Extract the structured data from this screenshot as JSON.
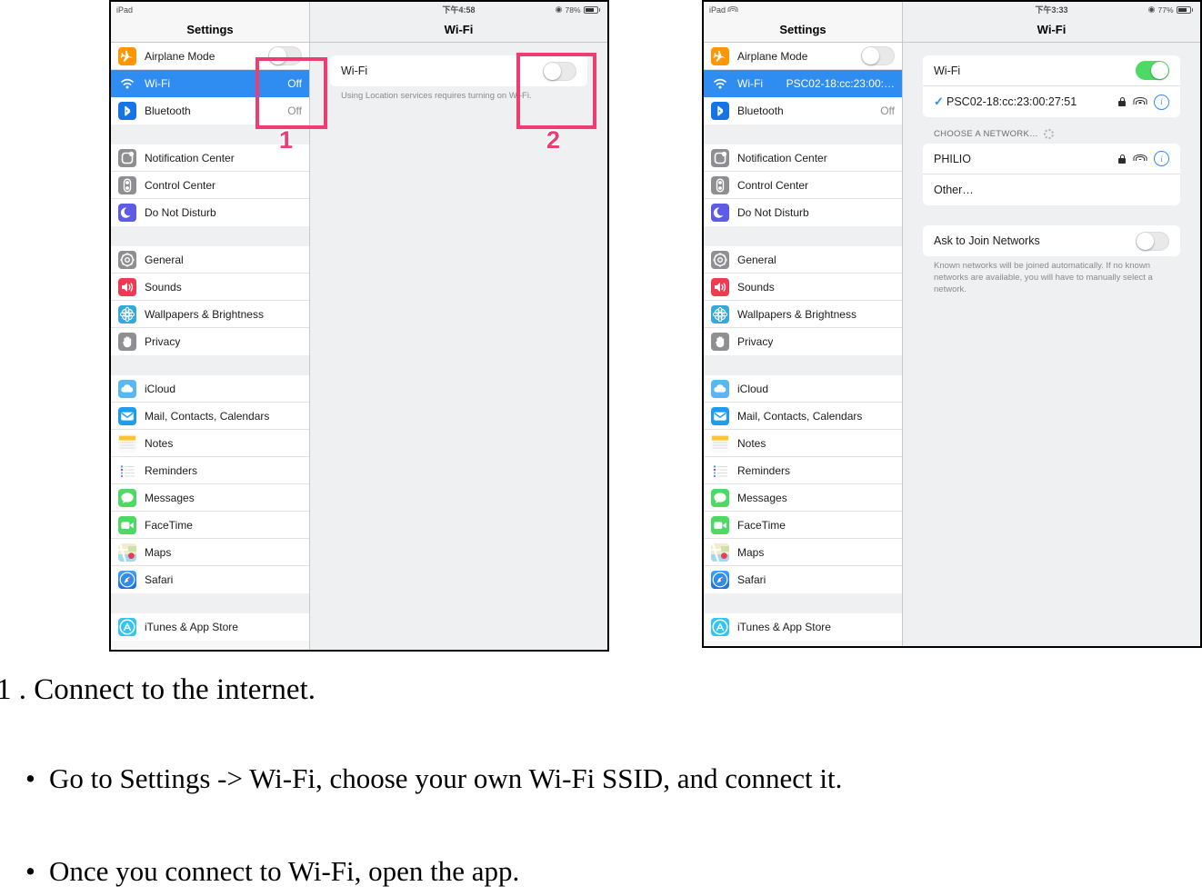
{
  "left_device": {
    "status": {
      "device": "iPad",
      "time": "下午4:58",
      "battery_pct": "78%",
      "battery_level": 78
    },
    "sidebar_title": "Settings",
    "detail_title": "Wi-Fi",
    "groups": [
      {
        "items": [
          {
            "label": "Airplane Mode",
            "icon": "airplane-icon",
            "control": "toggle",
            "toggle_on": false,
            "selected": false
          },
          {
            "label": "Wi-Fi",
            "icon": "wifi-icon",
            "value": "Off",
            "selected": true
          },
          {
            "label": "Bluetooth",
            "icon": "bluetooth-icon",
            "value": "Off",
            "selected": false
          }
        ]
      },
      {
        "items": [
          {
            "label": "Notification Center",
            "icon": "notification-center-icon",
            "selected": false
          },
          {
            "label": "Control Center",
            "icon": "control-center-icon",
            "selected": false
          },
          {
            "label": "Do Not Disturb",
            "icon": "do-not-disturb-icon",
            "selected": false
          }
        ]
      },
      {
        "items": [
          {
            "label": "General",
            "icon": "gear-icon",
            "selected": false
          },
          {
            "label": "Sounds",
            "icon": "sounds-icon",
            "selected": false
          },
          {
            "label": "Wallpapers & Brightness",
            "icon": "wallpapers-icon",
            "selected": false
          },
          {
            "label": "Privacy",
            "icon": "privacy-hand-icon",
            "selected": false
          }
        ]
      },
      {
        "items": [
          {
            "label": "iCloud",
            "icon": "icloud-icon",
            "selected": false
          },
          {
            "label": "Mail, Contacts, Calendars",
            "icon": "mail-icon",
            "selected": false
          },
          {
            "label": "Notes",
            "icon": "notes-icon",
            "selected": false
          },
          {
            "label": "Reminders",
            "icon": "reminders-icon",
            "selected": false
          },
          {
            "label": "Messages",
            "icon": "messages-icon",
            "selected": false
          },
          {
            "label": "FaceTime",
            "icon": "facetime-icon",
            "selected": false
          },
          {
            "label": "Maps",
            "icon": "maps-icon",
            "selected": false
          },
          {
            "label": "Safari",
            "icon": "safari-icon",
            "selected": false
          }
        ]
      },
      {
        "items": [
          {
            "label": "iTunes & App Store",
            "icon": "app-store-icon",
            "selected": false
          }
        ]
      }
    ],
    "detail": {
      "wifi_row_label": "Wi-Fi",
      "wifi_toggle_on": false,
      "footnote": "Using Location services requires turning on Wi-Fi."
    }
  },
  "right_device": {
    "status": {
      "device": "iPad",
      "wifi_icon": "wifi-status-icon",
      "time": "下午3:33",
      "battery_pct": "77%",
      "battery_level": 77
    },
    "sidebar_title": "Settings",
    "detail_title": "Wi-Fi",
    "groups": [
      {
        "items": [
          {
            "label": "Airplane Mode",
            "icon": "airplane-icon",
            "control": "toggle",
            "toggle_on": false,
            "selected": false
          },
          {
            "label": "Wi-Fi",
            "icon": "wifi-icon",
            "value": "PSC02-18:cc:23:00:…",
            "selected": true
          },
          {
            "label": "Bluetooth",
            "icon": "bluetooth-icon",
            "value": "Off",
            "selected": false
          }
        ]
      },
      {
        "items": [
          {
            "label": "Notification Center",
            "icon": "notification-center-icon",
            "selected": false
          },
          {
            "label": "Control Center",
            "icon": "control-center-icon",
            "selected": false
          },
          {
            "label": "Do Not Disturb",
            "icon": "do-not-disturb-icon",
            "selected": false
          }
        ]
      },
      {
        "items": [
          {
            "label": "General",
            "icon": "gear-icon",
            "selected": false
          },
          {
            "label": "Sounds",
            "icon": "sounds-icon",
            "selected": false
          },
          {
            "label": "Wallpapers & Brightness",
            "icon": "wallpapers-icon",
            "selected": false
          },
          {
            "label": "Privacy",
            "icon": "privacy-hand-icon",
            "selected": false
          }
        ]
      },
      {
        "items": [
          {
            "label": "iCloud",
            "icon": "icloud-icon",
            "selected": false
          },
          {
            "label": "Mail, Contacts, Calendars",
            "icon": "mail-icon",
            "selected": false
          },
          {
            "label": "Notes",
            "icon": "notes-icon",
            "selected": false
          },
          {
            "label": "Reminders",
            "icon": "reminders-icon",
            "selected": false
          },
          {
            "label": "Messages",
            "icon": "messages-icon",
            "selected": false
          },
          {
            "label": "FaceTime",
            "icon": "facetime-icon",
            "selected": false
          },
          {
            "label": "Maps",
            "icon": "maps-icon",
            "selected": false
          },
          {
            "label": "Safari",
            "icon": "safari-icon",
            "selected": false
          }
        ]
      },
      {
        "items": [
          {
            "label": "iTunes & App Store",
            "icon": "app-store-icon",
            "selected": false
          }
        ]
      }
    ],
    "detail": {
      "wifi_row_label": "Wi-Fi",
      "wifi_toggle_on": true,
      "connected_network": "PSC02-18:cc:23:00:27:51",
      "choose_header": "CHOOSE A NETWORK…",
      "networks": [
        "PHILIO"
      ],
      "other_label": "Other…",
      "ask_to_join_label": "Ask to Join Networks",
      "ask_to_join_on": false,
      "ask_footnote": "Known networks will be joined automatically. If no known networks are available, you will have to manually select a network."
    }
  },
  "annotations": {
    "marker_color": "#ee3d72",
    "items": [
      {
        "number": "1"
      },
      {
        "number": "2"
      }
    ]
  },
  "document_text": {
    "heading": "1 . Connect to the internet.",
    "bullet_1": "Go to Settings -> Wi-Fi, choose your own Wi-Fi SSID, and connect it.",
    "bullet_2": "Once you connect to Wi-Fi, open the app.",
    "bullet_glyph": "•"
  }
}
